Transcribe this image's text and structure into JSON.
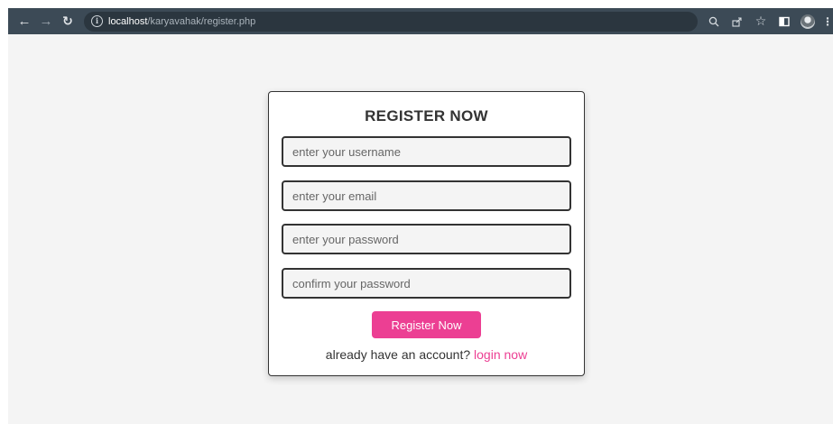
{
  "browser": {
    "url_host": "localhost",
    "url_path": "/karyavahak/register.php",
    "icons": {
      "back": "arrow-left-icon",
      "forward": "arrow-right-icon",
      "reload": "reload-icon",
      "site_info": "info-icon",
      "zoom": "search-icon",
      "share": "share-icon",
      "bookmark": "star-icon",
      "side_panel": "side-panel-icon",
      "profile": "avatar",
      "menu": "kebab-menu-icon"
    }
  },
  "form": {
    "title": "REGISTER NOW",
    "username_placeholder": "enter your username",
    "email_placeholder": "enter your email",
    "password_placeholder": "enter your password",
    "confirm_placeholder": "confirm your password",
    "submit_label": "Register Now",
    "login_prompt": "already have an account?",
    "login_link": "login now"
  },
  "colors": {
    "accent": "#ec3f93",
    "toolbar": "#3c4a56",
    "page_bg": "#f4f4f4"
  }
}
